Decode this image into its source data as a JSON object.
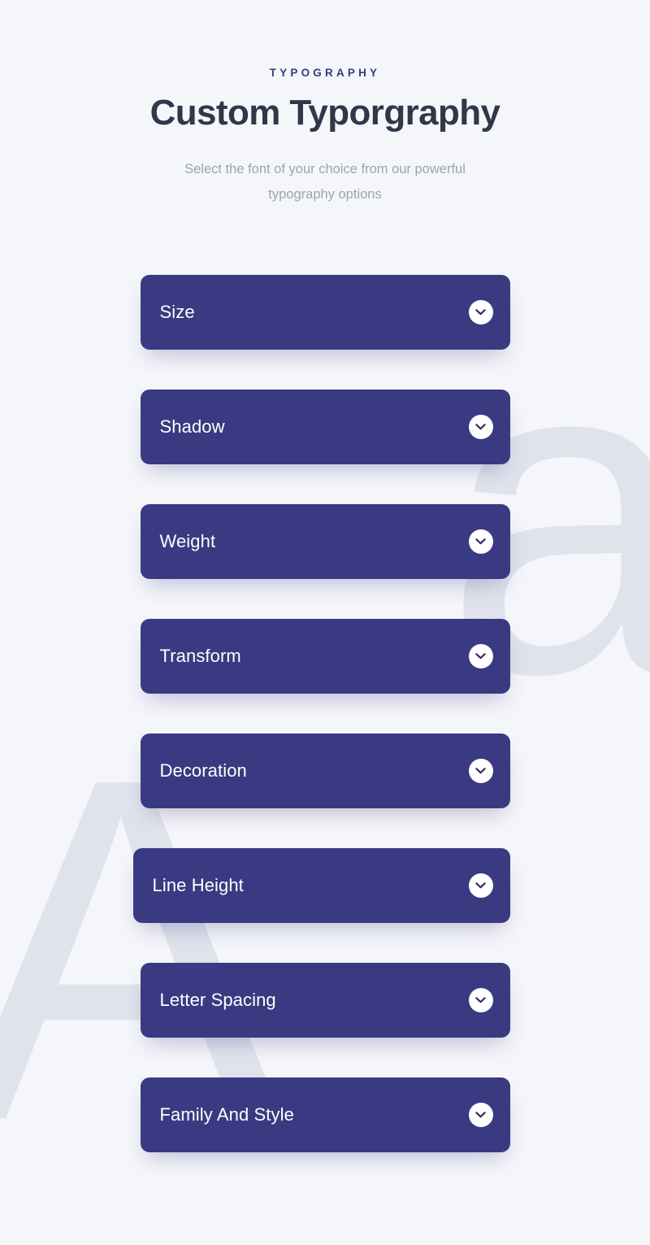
{
  "theme": {
    "page_background": "#f5f6fa",
    "accent": "#3a3a82",
    "title_color": "#323649",
    "subtitle_color": "#9ba3b4",
    "watermark_color": "#e1e3ec",
    "chevron_circle_color": "#ffffff"
  },
  "header": {
    "eyebrow": "TYPOGRAPHY",
    "title": "Custom Typorgraphy",
    "subtitle": "Select the font of your choice from our powerful typography options"
  },
  "background_watermarks": [
    {
      "glyph": "a",
      "name": "watermark-letter-a-lowercase"
    },
    {
      "glyph": "A",
      "name": "watermark-letter-a-uppercase"
    }
  ],
  "accordion": {
    "icon": "chevron-down-icon",
    "items": [
      {
        "label": "Size",
        "expanded": false
      },
      {
        "label": "Shadow",
        "expanded": false
      },
      {
        "label": "Weight",
        "expanded": false
      },
      {
        "label": "Transform",
        "expanded": false
      },
      {
        "label": "Decoration",
        "expanded": false
      },
      {
        "label": "Line Height",
        "expanded": false
      },
      {
        "label": "Letter Spacing",
        "expanded": false
      },
      {
        "label": "Family And Style",
        "expanded": false
      }
    ]
  }
}
